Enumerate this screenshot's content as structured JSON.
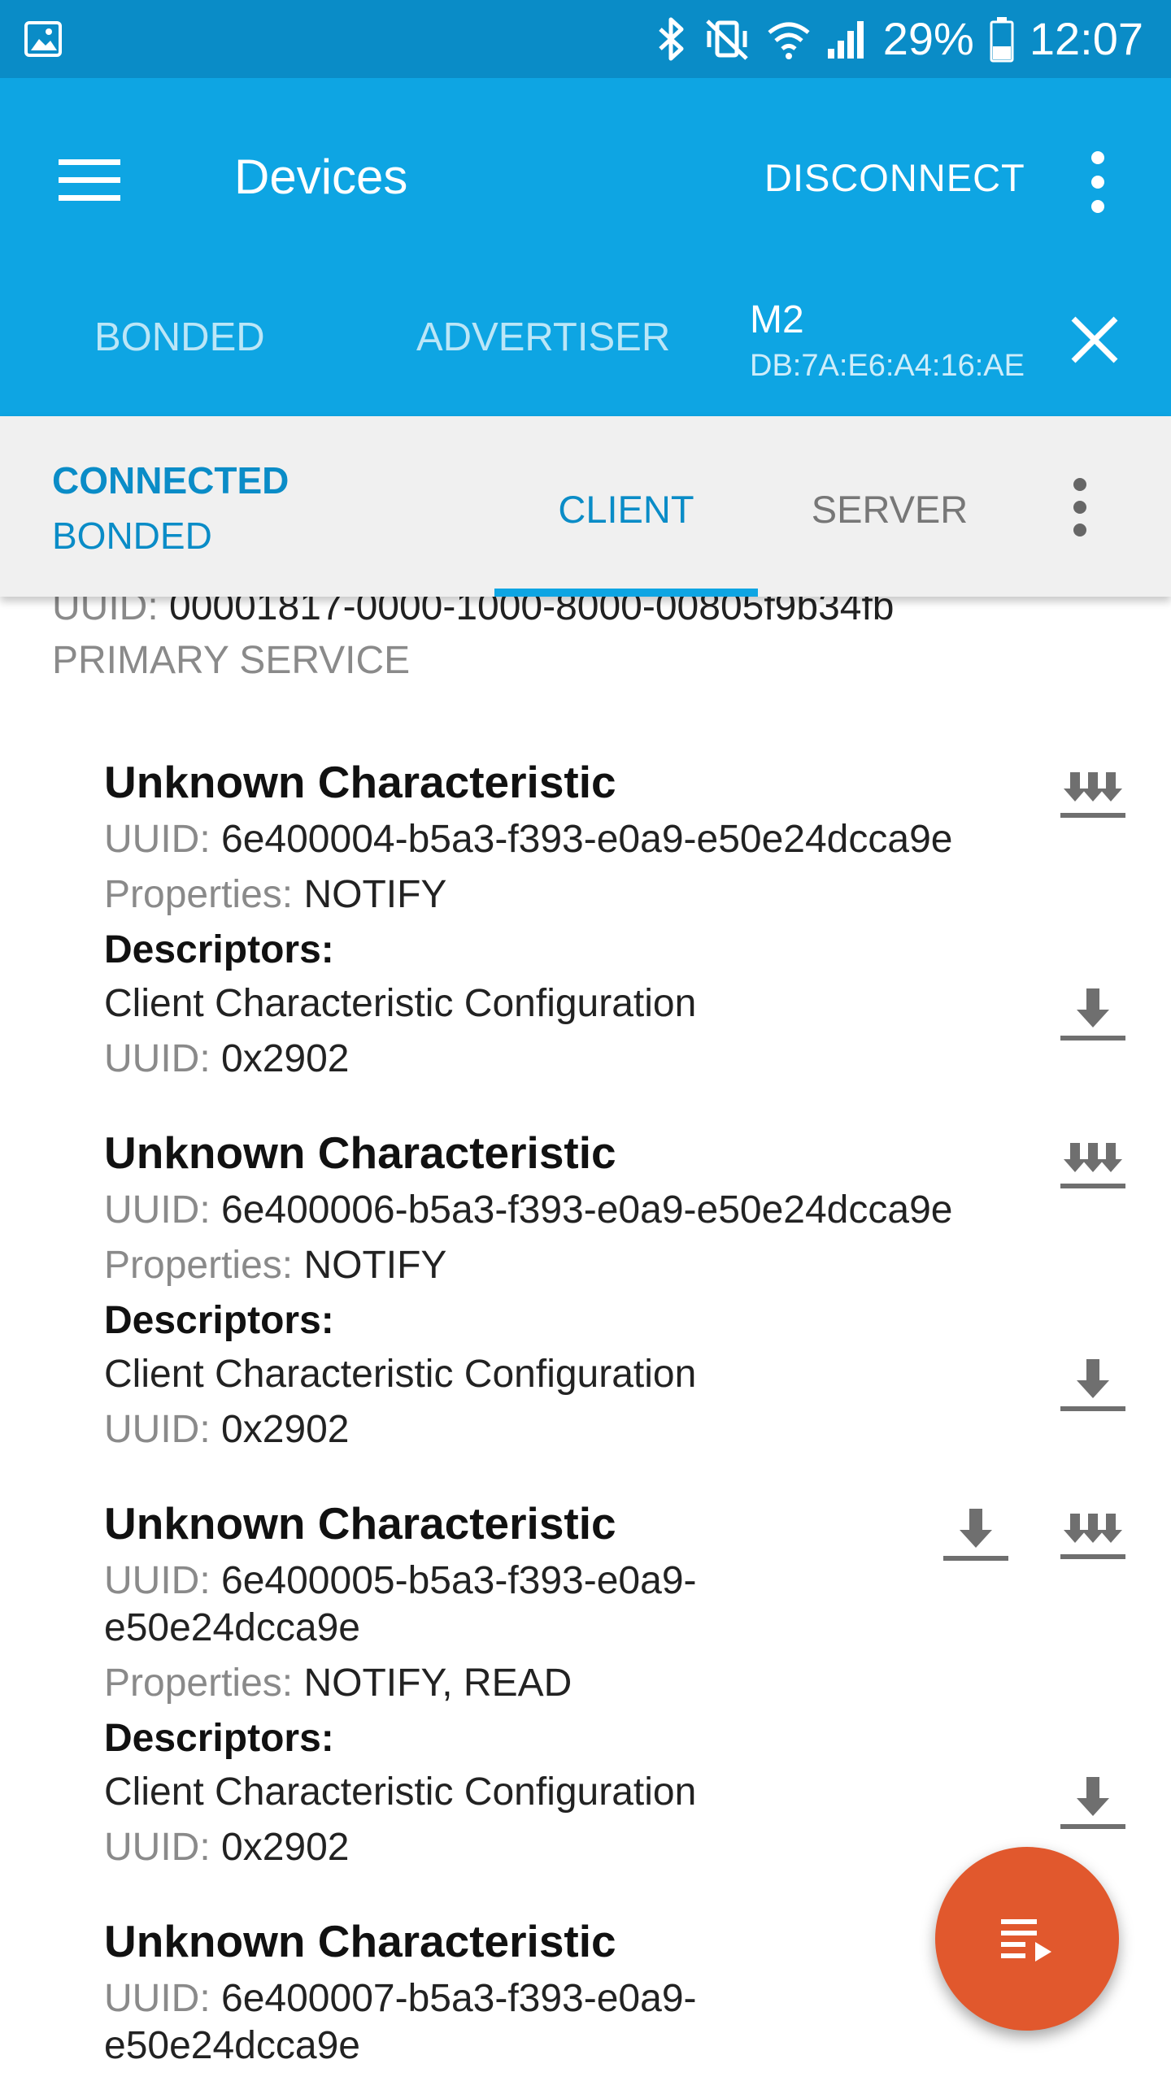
{
  "status_bar": {
    "battery": "29%",
    "time": "12:07"
  },
  "app_bar": {
    "title": "Devices",
    "disconnect": "DISCONNECT"
  },
  "device_tabs": {
    "bonded": "BONDED",
    "advertiser": "ADVERTISER",
    "device_name": "M2",
    "device_address": "DB:7A:E6:A4:16:AE"
  },
  "sub_bar": {
    "state_connected": "CONNECTED",
    "state_bonded": "BONDED",
    "client": "CLIENT",
    "server": "SERVER"
  },
  "service": {
    "uuid_label": "UUID:",
    "uuid_value": "00001817-0000-1000-8000-00805f9b34fb",
    "type": "PRIMARY SERVICE"
  },
  "characteristics": [
    {
      "name": "Unknown Characteristic",
      "uuid_label": "UUID:",
      "uuid_line1": "6e400004-b5a3-f393-e0a9-e50e24dcca9e",
      "properties_label": "Properties:",
      "properties": "NOTIFY",
      "descriptors_header": "Descriptors:",
      "descriptor_name": "Client Characteristic Configuration",
      "descriptor_uuid_label": "UUID:",
      "descriptor_uuid": "0x2902"
    },
    {
      "name": "Unknown Characteristic",
      "uuid_label": "UUID:",
      "uuid_line1": "6e400006-b5a3-f393-e0a9-e50e24dcca9e",
      "properties_label": "Properties:",
      "properties": "NOTIFY",
      "descriptors_header": "Descriptors:",
      "descriptor_name": "Client Characteristic Configuration",
      "descriptor_uuid_label": "UUID:",
      "descriptor_uuid": "0x2902"
    },
    {
      "name": "Unknown Characteristic",
      "uuid_label": "UUID:",
      "uuid_line1": "6e400005-b5a3-f393-e0a9-",
      "uuid_line2": "e50e24dcca9e",
      "properties_label": "Properties:",
      "properties": "NOTIFY, READ",
      "descriptors_header": "Descriptors:",
      "descriptor_name": "Client Characteristic Configuration",
      "descriptor_uuid_label": "UUID:",
      "descriptor_uuid": "0x2902"
    },
    {
      "name": "Unknown Characteristic",
      "uuid_label": "UUID:",
      "uuid_line1": "6e400007-b5a3-f393-e0a9-",
      "uuid_line2": "e50e24dcca9e"
    }
  ],
  "icons": {
    "status_gallery": "image-icon",
    "bluetooth": "bluetooth-icon",
    "mute": "vibrate-mute-icon",
    "wifi": "wifi-icon",
    "signal": "signal-icon",
    "battery": "battery-icon",
    "menu": "menu-icon",
    "more": "more-vert-icon",
    "close": "close-icon",
    "notify": "notify-icon",
    "read": "download-icon",
    "fab": "queue-play-icon"
  },
  "colors": {
    "status_bar": "#0A8CC7",
    "app_bar": "#0EA5E3",
    "accent": "#0A8CC7",
    "fab": "#E1582D",
    "sub_bar": "#F0F0F0"
  }
}
